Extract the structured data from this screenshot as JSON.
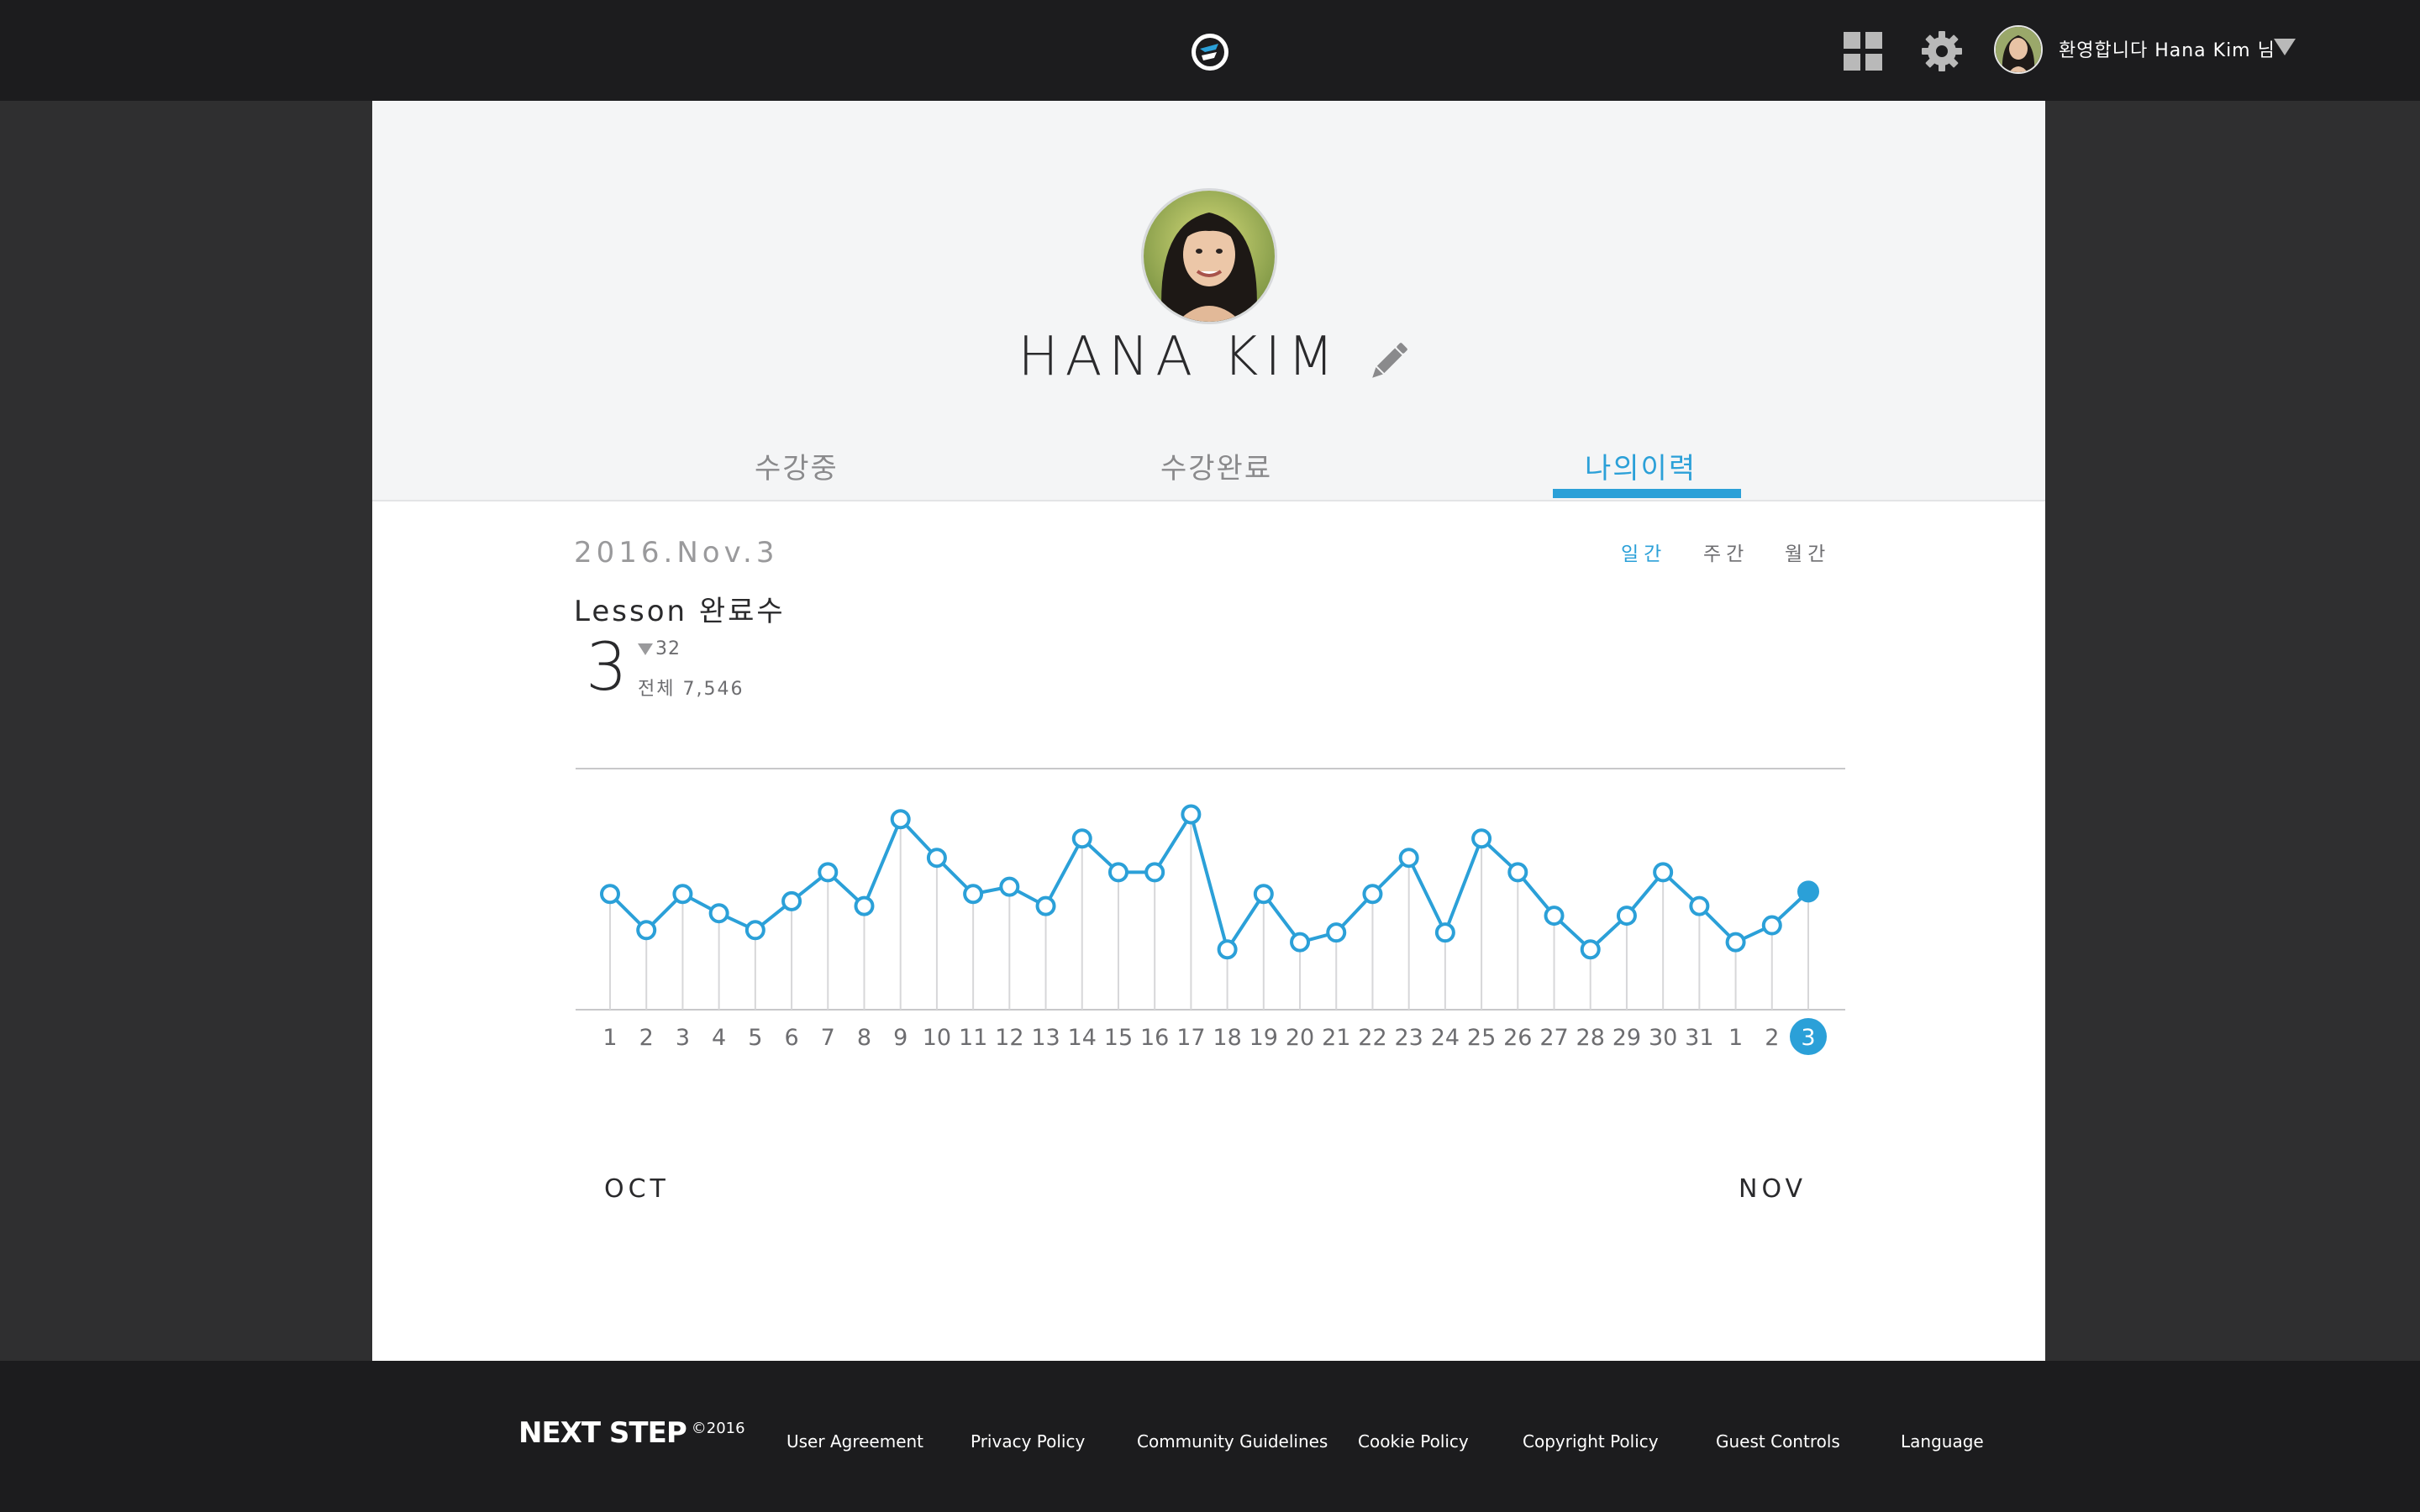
{
  "header": {
    "welcome_text": "환영합니다 Hana Kim 님",
    "icons": [
      "logo-mark",
      "apps-grid-icon",
      "gear-icon",
      "avatar",
      "chevron-down-icon"
    ]
  },
  "profile": {
    "name": "HANA KIM",
    "tabs": [
      {
        "label": "수강중",
        "active": false
      },
      {
        "label": "수강완료",
        "active": false
      },
      {
        "label": "나의이력",
        "active": true
      }
    ]
  },
  "history": {
    "date": "2016.Nov.3",
    "periods": [
      {
        "label": "일간",
        "active": true
      },
      {
        "label": "주간",
        "active": false
      },
      {
        "label": "월간",
        "active": false
      }
    ],
    "metric_title": "Lesson 완료수",
    "value": "3",
    "delta": "32",
    "total": "전체 7,546",
    "months": {
      "start": "OCT",
      "end": "NOV"
    }
  },
  "chart_data": {
    "type": "line",
    "x": [
      "1",
      "2",
      "3",
      "4",
      "5",
      "6",
      "7",
      "8",
      "9",
      "10",
      "11",
      "12",
      "13",
      "14",
      "15",
      "16",
      "17",
      "18",
      "19",
      "20",
      "21",
      "22",
      "23",
      "24",
      "25",
      "26",
      "27",
      "28",
      "29",
      "30",
      "31",
      "1",
      "2",
      "3"
    ],
    "values": [
      48,
      33,
      48,
      40,
      33,
      45,
      57,
      43,
      79,
      63,
      48,
      51,
      43,
      71,
      57,
      57,
      81,
      25,
      48,
      28,
      32,
      48,
      63,
      32,
      71,
      57,
      39,
      25,
      39,
      57,
      43,
      28,
      35,
      49
    ],
    "highlight_index": 33,
    "ylim": [
      0,
      100
    ],
    "grid": false,
    "colors": {
      "line": "#2ba0d8",
      "marker_fill": "#ffffff",
      "drop_line": "#d7d7d9",
      "axis": "#c8c8ca",
      "tick_text": "#6d6d70"
    }
  },
  "footer": {
    "brand": "NEXT STEP",
    "copyright": "©2016",
    "links": [
      "User Agreement",
      "Privacy Policy",
      "Community Guidelines",
      "Cookie Policy",
      "Copyright Policy",
      "Guest Controls",
      "Language"
    ]
  }
}
